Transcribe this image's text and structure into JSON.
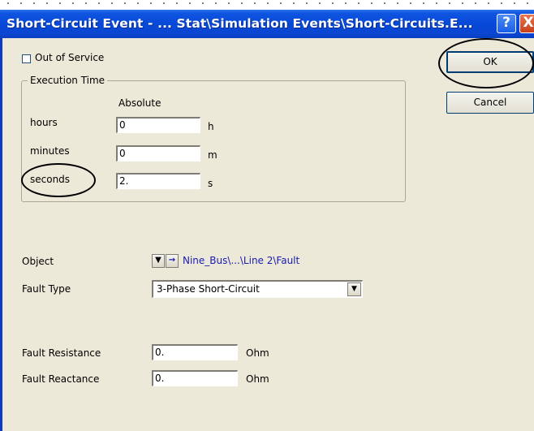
{
  "window": {
    "title": "Short-Circuit Event - ... Stat\\Simulation Events\\Short-Circuits.E...",
    "help_icon": "?",
    "close_icon": "X"
  },
  "out_of_service": {
    "label": "Out of Service",
    "checked": false
  },
  "buttons": {
    "ok": "OK",
    "cancel": "Cancel"
  },
  "execution_time": {
    "legend": "Execution Time",
    "mode_label": "Absolute",
    "rows": [
      {
        "label": "hours",
        "value": "0",
        "unit": "h"
      },
      {
        "label": "minutes",
        "value": "0",
        "unit": "m"
      },
      {
        "label": "seconds",
        "value": "2.",
        "unit": "s"
      }
    ]
  },
  "object": {
    "label": "Object",
    "dropdown_icon": "▼",
    "jump_icon": "→",
    "value": "Nine_Bus\\...\\Line 2\\Fault"
  },
  "fault_type": {
    "label": "Fault Type",
    "value": "3-Phase Short-Circuit"
  },
  "fault_resistance": {
    "label": "Fault Resistance",
    "value": "0.",
    "unit": "Ohm"
  },
  "fault_reactance": {
    "label": "Fault Reactance",
    "value": "0.",
    "unit": "Ohm"
  },
  "colors": {
    "titlebar": "#0848d8",
    "dialog_bg": "#ece9d8",
    "link": "#1a1ab4"
  }
}
